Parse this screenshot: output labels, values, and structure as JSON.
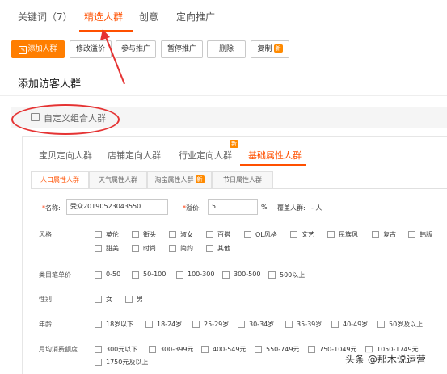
{
  "top_tabs": [
    "关键词（7）",
    "精选人群",
    "创意",
    "定向推广"
  ],
  "toolbar": {
    "add_crowd": "添加人群",
    "modify_bid": "修改溢价",
    "join_promo": "参与推广",
    "pause_promo": "暂停推广",
    "delete": "删除",
    "copy": "复制",
    "copy_badge": "新"
  },
  "section_title": "添加访客人群",
  "custom_crowd": "自定义组合人群",
  "builder_tabs": [
    "宝贝定向人群",
    "店铺定向人群",
    "行业定向人群",
    "基础属性人群"
  ],
  "builder_new_badge": "新",
  "type_tabs": [
    "人口属性人群",
    "天气属性人群",
    "淘宝属性人群",
    "节日属性人群"
  ],
  "type_new_badge": "新",
  "form": {
    "name_label": "名称:",
    "name_value": "受众20190523043550",
    "bid_label": "溢价:",
    "bid_value": "5",
    "bid_unit": "%",
    "cover_label": "覆盖人群:",
    "cover_value": "- 人"
  },
  "style": {
    "label": "风格",
    "row1": [
      "英伦",
      "街头",
      "淑女",
      "百搭",
      "OL风格",
      "文艺",
      "民族风",
      "复古",
      "韩版"
    ],
    "row2": [
      "甜美",
      "时尚",
      "简约",
      "其他"
    ]
  },
  "avg_price": {
    "label": "类目笔单价",
    "options": [
      "0-50",
      "50-100",
      "100-300",
      "300-500",
      "500以上"
    ]
  },
  "gender": {
    "label": "性别",
    "options": [
      "女",
      "男"
    ]
  },
  "age": {
    "label": "年龄",
    "options": [
      "18岁以下",
      "18-24岁",
      "25-29岁",
      "30-34岁",
      "35-39岁",
      "40-49岁",
      "50岁及以上"
    ]
  },
  "spend": {
    "label": "月均消费额度",
    "row1": [
      "300元以下",
      "300-399元",
      "400-549元",
      "550-749元",
      "750-1049元",
      "1050-1749元"
    ],
    "row2": [
      "1750元及以上"
    ]
  },
  "watermark": "头条 @那木说运营",
  "colors": {
    "accent": "#ff5000",
    "primary_button": "#ff7e00",
    "annotation": "#e53333"
  }
}
